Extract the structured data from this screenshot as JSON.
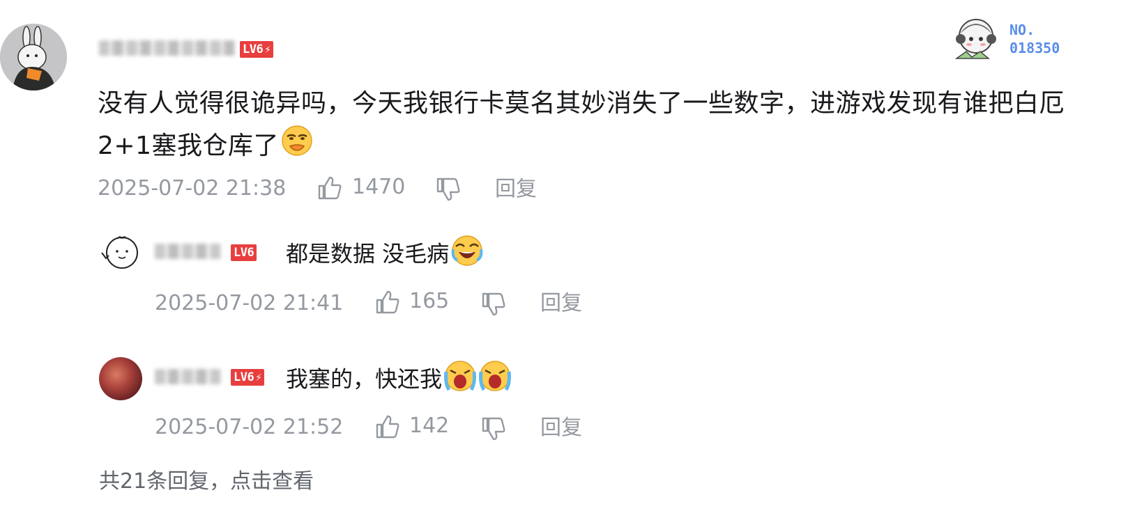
{
  "comment": {
    "level": "LV6",
    "text": "没有人觉得很诡异吗，今天我银行卡莫名其妙消失了一些数字，进游戏发现有谁把白厄2+1塞我仓库了",
    "text_line1": "没有人觉得很诡异吗，今天我银行卡莫名其妙消失了一些数字，进游戏发现有谁把白厄",
    "text_line2": "2+1塞我仓库了",
    "emoji": "doge-face-icon",
    "timestamp": "2025-07-02 21:38",
    "likes": "1470",
    "reply_label": "回复",
    "badge_no_label": "NO.",
    "badge_no_value": "018350"
  },
  "replies": [
    {
      "level": "LV6",
      "text": "都是数据 没毛病",
      "emoji": "laughing-crying-face-icon",
      "timestamp": "2025-07-02 21:41",
      "likes": "165",
      "reply_label": "回复"
    },
    {
      "level": "LV6",
      "text": "我塞的，快还我",
      "emoji": "loud-crying-face-icon",
      "timestamp": "2025-07-02 21:52",
      "likes": "142",
      "reply_label": "回复"
    }
  ],
  "more_replies": "共21条回复，点击查看",
  "colors": {
    "level_badge": "#e83e3e",
    "meta_text": "#9499a0",
    "body_text": "#18191c",
    "badge_blue": "#5a8de8"
  }
}
